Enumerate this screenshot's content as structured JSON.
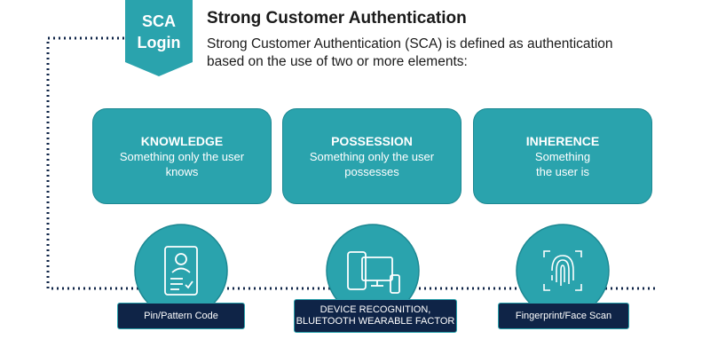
{
  "badge": {
    "line1": "SCA",
    "line2": "Login"
  },
  "header": {
    "title": "Strong Customer Authentication",
    "description": "Strong Customer Authentication (SCA) is defined as authentication based on the use of two or more elements:"
  },
  "elements": [
    {
      "title": "KNOWLEDGE",
      "desc_line1": "Something only the user",
      "desc_line2": "knows"
    },
    {
      "title": "POSSESSION",
      "desc_line1": "Something only the user",
      "desc_line2": "possesses"
    },
    {
      "title": "INHERENCE",
      "desc_line1": "Something",
      "desc_line2": "the user is"
    }
  ],
  "examples": [
    {
      "label": "Pin/Pattern Code",
      "icon": "id-card-icon"
    },
    {
      "label_line1": "DEVICE RECOGNITION,",
      "label_line2": "BLUETOOTH WEARABLE FACTOR",
      "icon": "devices-icon"
    },
    {
      "label": "Fingerprint/Face Scan",
      "icon": "fingerprint-icon"
    }
  ],
  "colors": {
    "teal": "#2aa3ad",
    "teal_dark": "#1d8892",
    "navy": "#0f2447",
    "text": "#1a1a1a"
  }
}
